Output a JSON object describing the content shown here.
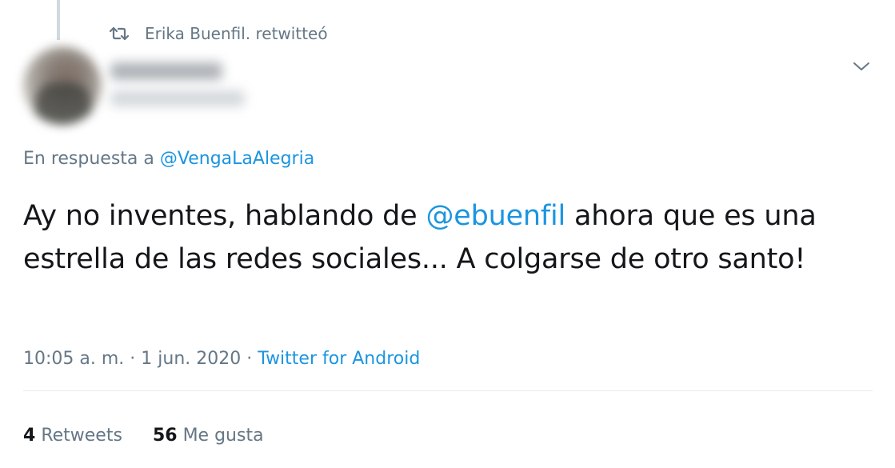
{
  "retweet_context": {
    "text": "Erika Buenfil. retwitteó",
    "icon": "retweet-icon"
  },
  "author": {
    "avatar_icon": "avatar-blurred",
    "name_blurred": true,
    "handle_blurred": true
  },
  "reply_to": {
    "prefix": "En respuesta a",
    "handle": "@VengaLaAlegria"
  },
  "tweet": {
    "text_before": "Ay no inventes, hablando de",
    "mention": "@ebuenfil",
    "text_after": "ahora que es una estrella de las redes sociales... A colgarse de otro santo!"
  },
  "meta": {
    "time": "10:05 a. m.",
    "separator": "·",
    "date": "1 jun. 2020",
    "source": "Twitter for Android"
  },
  "stats": {
    "retweets_count": "4",
    "retweets_label": "Retweets",
    "likes_count": "56",
    "likes_label": "Me gusta"
  },
  "colors": {
    "link": "#1b95e0",
    "secondary_text": "#657786",
    "primary_text": "#14171a",
    "divider": "#e6ecf0"
  },
  "menu_icon": "chevron-down-icon"
}
